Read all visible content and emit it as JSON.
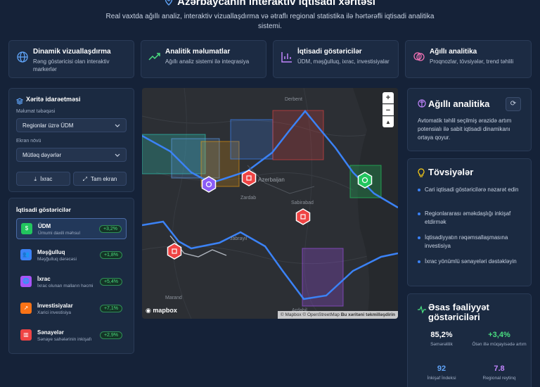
{
  "header": {
    "title": "Azərbaycanın interaktiv iqtisadi xəritəsi",
    "subtitle": "Real vaxtda ağıllı analiz, interaktiv vizuallaşdırma və ətraflı regional statistika ilə hərtərəfli iqtisadi analitika sistemi."
  },
  "features": [
    {
      "title": "Dinamik vizuallaşdırma",
      "desc": "Rəng göstəricisi olan interaktiv markerlər",
      "icon": "globe-icon"
    },
    {
      "title": "Analitik məlumatlar",
      "desc": "Ağıllı analiz sistemi ilə inteqrasiya",
      "icon": "trend-icon"
    },
    {
      "title": "İqtisadi göstəricilər",
      "desc": "ÜDM, məşğulluq, ixrac, investisiyalar",
      "icon": "bar-chart-icon"
    },
    {
      "title": "Ağıllı analitika",
      "desc": "Proqnozlar, tövsiyələr, trend təhlili",
      "icon": "brain-icon"
    }
  ],
  "controls": {
    "title": "Xəritə idarəetməsi",
    "layer_label": "Məlumat təbəqəsi",
    "layer_value": "Regionlar üzrə ÜDM",
    "mode_label": "Ekran növü",
    "mode_value": "Mütləq dəyərlər",
    "export_label": "İxrac",
    "fullscreen_label": "Tam ekran"
  },
  "indicators": {
    "title": "İqtisadi göstəricilər",
    "items": [
      {
        "name": "ÜDM",
        "sub": "Ümumi daxili məhsul",
        "pct": "+3,2%",
        "color": "#22c55e",
        "glyph": "$"
      },
      {
        "name": "Məşğulluq",
        "sub": "Məşğulluq dərəcəsi",
        "pct": "+1,8%",
        "color": "#3b82f6",
        "glyph": "👥"
      },
      {
        "name": "İxrac",
        "sub": "İxrac olunan malların həcmi",
        "pct": "+5,4%",
        "color": "#a855f7",
        "glyph": "🌐"
      },
      {
        "name": "İnvestisiyalar",
        "sub": "Xarici investisiya",
        "pct": "+7,1%",
        "color": "#f97316",
        "glyph": "↗"
      },
      {
        "name": "Sənayelər",
        "sub": "Sənaye sahələrinin inkişafı",
        "pct": "+2,9%",
        "color": "#ef4444",
        "glyph": "▥"
      }
    ]
  },
  "map": {
    "labels": {
      "derbent": "Derbent",
      "azerbaijan": "Azerbaijan",
      "sabirabad": "Sabirabad",
      "zardab": "Zardab",
      "jabrayil": "Jabrayil",
      "marand": "Marand",
      "ardabil": "Ardabil"
    },
    "logo": "mapbox",
    "attribution": "© Mapbox © OpenStreetMap",
    "improve": "Bu xəritəni təkmilləşdirin",
    "zoom_in": "+",
    "zoom_out": "−",
    "compass": "▲"
  },
  "smart": {
    "title": "Ağıllı analitika",
    "text": "Avtomatik təhlil seçilmiş ərazidə artım potensialı ilə sabit iqtisadi dinamikanı ortaya qoyur."
  },
  "recommendations": {
    "title": "Tövsiyələr",
    "items": [
      "Cari iqtisadi göstəricilərə nəzarət edin",
      "Regionlararası əməkdaşlığı inkişaf etdirmək",
      "İqtisadiyyatın rəqəmsallaşmasına investisiya",
      "İxrac yönümlü sənayeləri dəstəkləyin"
    ]
  },
  "activity": {
    "title": "Əsas fəaliyyət göstəriciləri",
    "stats": [
      {
        "value": "85,2%",
        "label": "Səmərəlilik",
        "color": "#ffffff"
      },
      {
        "value": "+3,4%",
        "label": "Ötən illə müqayisədə artım",
        "color": "#4ade80"
      },
      {
        "value": "92",
        "label": "İnkişaf İndeksi",
        "color": "#60a5fa"
      },
      {
        "value": "7.8",
        "label": "Regional reytinq",
        "color": "#c084fc"
      }
    ]
  }
}
